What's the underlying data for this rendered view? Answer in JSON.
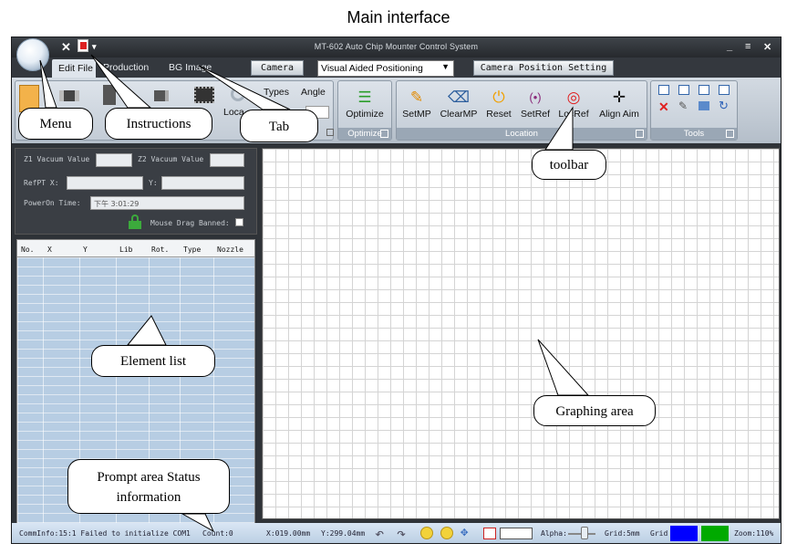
{
  "figure_title": "Main interface",
  "window": {
    "title": "MT-602 Auto Chip Mounter Control System",
    "qat_symbols": [
      "✕",
      "▾"
    ],
    "controls": [
      "_",
      "≡",
      "✕"
    ]
  },
  "tabs": [
    {
      "label": "Edit File",
      "active": true
    },
    {
      "label": "Production"
    },
    {
      "label": "BG Image"
    }
  ],
  "toolbar_row": {
    "camera_button": "Camera",
    "position_mode": "Visual Aided Positioning",
    "camera_setting_button": "Camera Position Setting"
  },
  "ribbon": {
    "element_group": {
      "visible_labels": [
        "Types",
        "Angle",
        "Loca"
      ]
    },
    "optimize_group": {
      "button": "Optimize",
      "label": "Optimize"
    },
    "location_group": {
      "buttons": [
        "SetMP",
        "ClearMP",
        "Reset",
        "SetRef",
        "LocRef",
        "Align Aim"
      ],
      "label": "Location"
    },
    "tools_group": {
      "label": "Tools"
    }
  },
  "params": {
    "z1_label": "Z1 Vacuum Value",
    "z2_label": "Z2 Vacuum Value",
    "refpt_label": "RefPT X:",
    "y_label": "Y:",
    "poweron_label": "PowerOn Time:",
    "poweron_value": "下午 3:01:29",
    "mouse_drag_label": "Mouse Drag Banned:"
  },
  "element_list": {
    "columns": [
      "No.",
      "X",
      "Y",
      "Lib",
      "Rot.",
      "Type",
      "Nozzle"
    ]
  },
  "status": {
    "comm": "CommInfo:15:1 Failed to initialize COM1",
    "count": "Count:0",
    "x": "X:019.00mm",
    "y": "Y:299.04mm",
    "alpha_label": "Alpha:",
    "grid_size": "Grid:5mm",
    "grid_label": "Grid",
    "zoom": "Zoom:110%"
  },
  "callouts": {
    "menu": "Menu",
    "instructions": "Instructions",
    "tab": "Tab",
    "toolbar": "toolbar",
    "element_list": "Element list",
    "graphing": "Graphing area",
    "prompt_line1": "Prompt area Status",
    "prompt_line2": "information"
  },
  "colors": {
    "dark_frame": "#2f3338",
    "ribbon": "#c3ccd6",
    "list_bg": "#b7cde3",
    "status_bg": "#c9d9ea",
    "grid_blue": "#0000ff",
    "grid_green": "#00aa00",
    "lock_green": "#3caa3c",
    "reset_orange": "#f0a000",
    "locref_red": "#e02020"
  }
}
